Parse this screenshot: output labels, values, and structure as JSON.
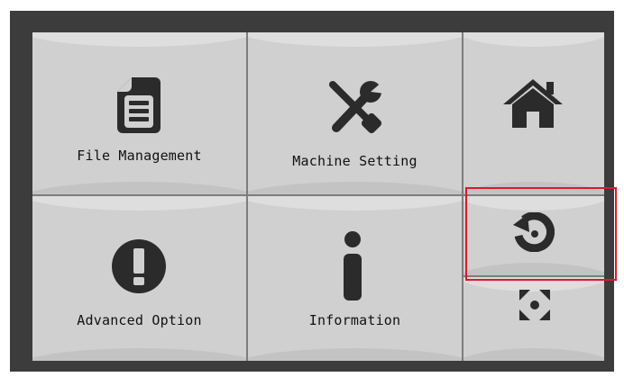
{
  "menu": {
    "file_management": "File Management",
    "machine_setting": "Machine Setting",
    "advanced_option": "Advanced Option",
    "information": "Information"
  },
  "icons": {
    "file": "file-icon",
    "settings": "wrench-screwdriver-icon",
    "home": "home-icon",
    "refresh": "refresh-icon",
    "advanced": "exclamation-icon",
    "info": "info-icon",
    "focus": "focus-icon"
  },
  "colors": {
    "tile": "#d0d0d0",
    "icon": "#2b2b2b",
    "frame": "#3c3c3c",
    "highlight": "#e0182a"
  }
}
